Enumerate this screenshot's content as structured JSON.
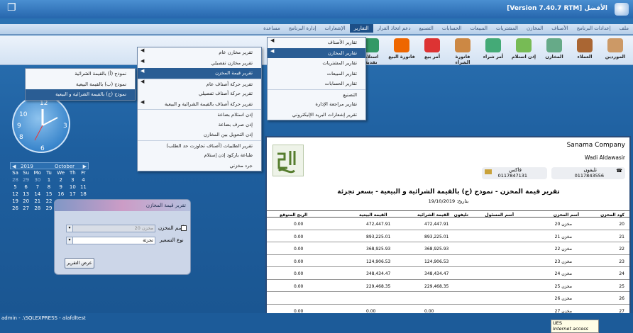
{
  "window": {
    "title": "الأفضل [Version 7.40.7 RTM]"
  },
  "menubar": [
    "ملف",
    "إعدادات البرنامج",
    "الأصناف",
    "المخازن",
    "المشتريات",
    "المبيعات",
    "الحسابات",
    "التصنيع",
    "دعم اتخاذ القرار",
    "التقارير",
    "الإشعارات",
    "إدارة البرنامج",
    "مساعدة"
  ],
  "toolbar": [
    "الموردين",
    "العملاء",
    "المخازن",
    "إذن استلام",
    "أمر شراء",
    "فاتورة الشراء",
    "أمر بيع",
    "فاتورة البيع",
    "استلام نقدية"
  ],
  "reports_menu": [
    "تقارير الأصناف",
    "تقارير المخازن",
    "تقارير المشتريات",
    "تقارير المبيعات",
    "تقارير الحسابات",
    "التصنيع",
    "تقارير مراجعة الإدارة",
    "تقرير إشعارات البريد الإليكتروني"
  ],
  "stores_menu": [
    "تقرير مخازن عام",
    "تقرير مخازن تفصيلي",
    "تقرير قيمة المخزن",
    "تقرير حركة أصناف عام",
    "تقرير حركة أصناف تفصيلي",
    "تقرير حركة أصناف بالقيمة الشرائية و البيعية",
    "إذن استلام بضاعة",
    "إذن صرف بضاعة",
    "إذن التحويل بين المخازن",
    "تقرير الطلبيات (أصناف تجاوزت حد الطلب)",
    "طباعة باركود إذن إستلام",
    "جرد مخزني"
  ],
  "value_menu": [
    "نموذج (أ) بالقيمة الشرائية",
    "نموذج (ب) بالقيمة البيعية",
    "نموذج (ج) بالقيمة الشرائية و البيعية"
  ],
  "calendar": {
    "year": "2019",
    "month": "October",
    "days": [
      "Sa",
      "Su",
      "Mo",
      "Tu",
      "We",
      "Th",
      "Fr"
    ],
    "rows": [
      [
        "28",
        "29",
        "30",
        "1",
        "2",
        "3",
        "4"
      ],
      [
        "5",
        "6",
        "7",
        "8",
        "9",
        "10",
        "11"
      ],
      [
        "12",
        "13",
        "14",
        "15",
        "16",
        "17",
        "18"
      ],
      [
        "19",
        "20",
        "21",
        "22",
        "23",
        "24",
        "25"
      ],
      [
        "26",
        "27",
        "28",
        "29",
        "30",
        "31",
        "1"
      ]
    ]
  },
  "dialog": {
    "title": "تقرير قيمة المخازن",
    "store_label": "أسم المخزن",
    "store_value": "مخزن 20",
    "pricing_label": "نوع التسعير",
    "pricing_value": "تجزئة",
    "show_button": "عرض التقرير"
  },
  "report": {
    "company": "Sanama Company",
    "address": "Wadi Aldawasir",
    "phone_label": "تليفون",
    "phone": "0117843556",
    "fax_label": "فاكس",
    "fax": "0117847131",
    "title": "تقرير قيمة المخزن - نموذج (ج) بالقيمة الشرائية و البيعية - بسعر  تجزئة",
    "date": "19/10/2019 :بتاريخ",
    "columns": [
      "كود المخزن",
      "أسم المخزن",
      "أسم المسئول",
      "تليفون",
      "القيمة الشرائية",
      "القيمة البيعية",
      "الربح المتوقع"
    ],
    "rows": [
      [
        "20",
        "مخزن 20",
        "",
        "",
        "472,447.91",
        "472,447.91",
        "0.00"
      ],
      [
        "21",
        "مخزن 21",
        "",
        "",
        "893,225.01",
        "893,225.01",
        "0.00"
      ],
      [
        "22",
        "مخزن 22",
        "",
        "",
        "368,925.93",
        "368,925.93",
        "0.00"
      ],
      [
        "23",
        "مخزن 23",
        "",
        "",
        "124,906.53",
        "124,906.53",
        "0.00"
      ],
      [
        "24",
        "مخزن 24",
        "",
        "",
        "348,434.47",
        "348,434.47",
        "0.00"
      ],
      [
        "25",
        "مخزن 25",
        "",
        "",
        "229,468.35",
        "229,468.35",
        "0.00"
      ],
      [
        "26",
        "مخزن 26",
        "",
        "",
        "",
        "",
        ""
      ],
      [
        "27",
        "مخزن 27",
        "",
        "",
        "0.00",
        "0.00",
        "0.00"
      ]
    ]
  },
  "status": {
    "text": "admin - .\\SQLEXPRESS - alafdltest"
  },
  "tooltip": {
    "l1": "UES",
    "l2": "Internet access"
  }
}
